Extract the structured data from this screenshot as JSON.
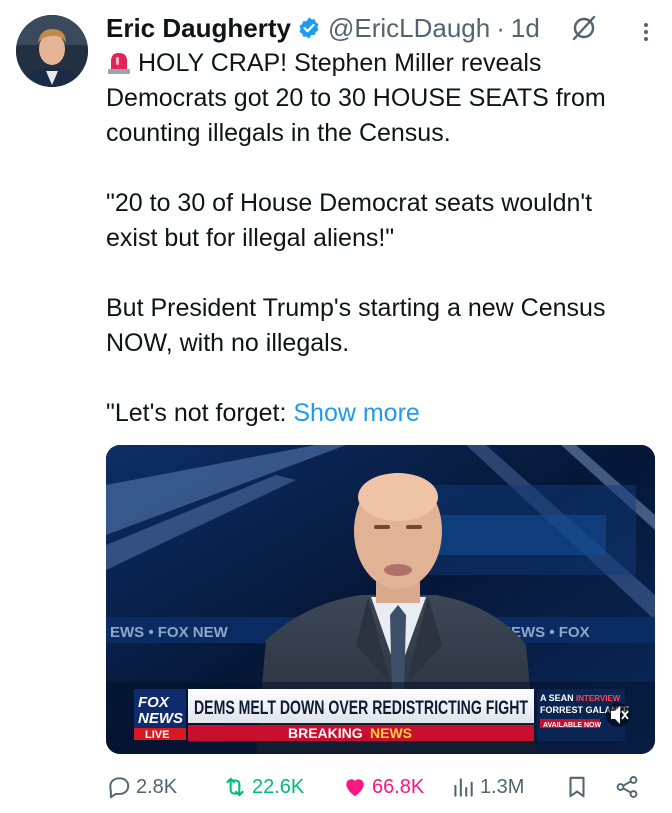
{
  "author": {
    "name": "Eric Daugherty",
    "handle": "@EricLDaugh",
    "separator": "·",
    "time": "1d"
  },
  "post": {
    "line1": "HOLY CRAP! Stephen Miller reveals",
    "line2": "Democrats got 20 to 30 HOUSE SEATS from",
    "line3": "counting illegals in the Census.",
    "quote1": "\"20 to 30 of House Democrat seats wouldn't",
    "quote2": "exist but for illegal aliens!\"",
    "para3_1": "But President Trump's starting a new Census",
    "para3_2": "NOW, with no illegals.",
    "para4": "\"Let's not forget: ",
    "show_more": "Show more"
  },
  "media": {
    "channel_logo_top": "FOX",
    "channel_logo_bottom": "NEWS",
    "live": "LIVE",
    "headline": "DEMS MELT DOWN OVER REDISTRICTING FIGHT",
    "breaking_1": "BREAKING",
    "breaking_2": "NEWS",
    "promo_1": "A SEAN",
    "promo_2": "INTERVIEW",
    "promo_3": "FORREST GALANTE",
    "promo_4": "AVAILABLE NOW",
    "ticker_left": "EWS  •  FOX NEW",
    "ticker_right": "X NEWS  •  FOX"
  },
  "actions": {
    "replies": "2.8K",
    "reposts": "22.6K",
    "likes": "66.8K",
    "views": "1.3M"
  },
  "colors": {
    "text": "#0f1419",
    "secondary": "#536471",
    "link": "#1d9bf0",
    "repost": "#00ba7c",
    "like": "#f91880",
    "verified": "#1d9bf0"
  }
}
